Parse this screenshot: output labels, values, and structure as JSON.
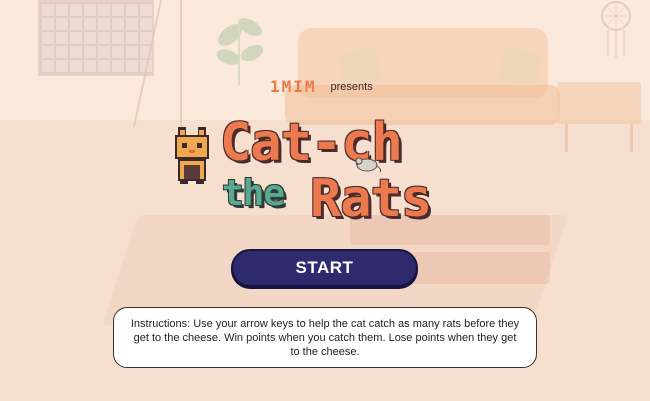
{
  "brand": "1MIM",
  "presents": "presents",
  "title": {
    "line1": "Cat-ch",
    "the": "the",
    "line2": "Rats"
  },
  "start_button": "START",
  "instructions": "Instructions: Use your arrow keys to help the cat catch as many rats before they get to the cheese. Win points when you catch them. Lose points when they get to the cheese.",
  "icons": {
    "cat": "cat-icon",
    "rat": "rat-icon"
  },
  "colors": {
    "background": "#f8e4d6",
    "title_orange": "#ec7a4e",
    "title_teal": "#5aa890",
    "button": "#2e2a6e"
  }
}
